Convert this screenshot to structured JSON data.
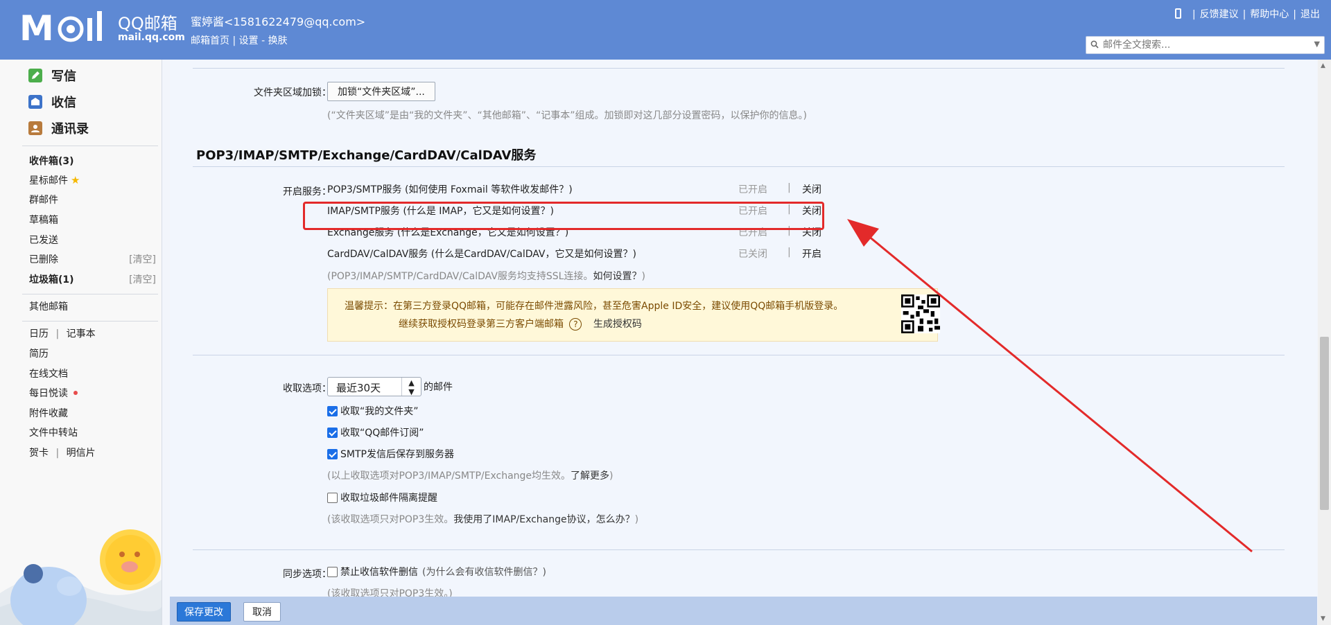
{
  "header": {
    "logo_text": "M",
    "logo_brand": "QQ邮箱",
    "logo_domain": "mail.qq.com",
    "user_display": "蜜婷酱<1581622479@qq.com>",
    "links": {
      "home": "邮箱首页",
      "settings": "设置",
      "skin": "换肤"
    },
    "right_links": {
      "feedback": "反馈建议",
      "help": "帮助中心",
      "logout": "退出"
    },
    "search_placeholder": "邮件全文搜索..."
  },
  "sidebar": {
    "actions": {
      "write": "写信",
      "receive": "收信",
      "contacts": "通讯录"
    },
    "folders": {
      "inbox": "收件箱(3)",
      "starred": "星标邮件",
      "group": "群邮件",
      "drafts": "草稿箱",
      "sent": "已发送",
      "deleted": "已删除",
      "deleted_clear": "[清空]",
      "spam": "垃圾箱(1)",
      "spam_clear": "[清空]",
      "other_mailboxes": "其他邮箱",
      "calendar": "日历",
      "notepad": "记事本",
      "resume": "简历",
      "online_docs": "在线文档",
      "daily_reading": "每日悦读",
      "attachments": "附件收藏",
      "file_transfer": "文件中转站",
      "cards": "贺卡",
      "postcards": "明信片"
    },
    "colors": {
      "star": "#f5b800",
      "dot": "#e74c4c"
    }
  },
  "main": {
    "folder_lock": {
      "label": "文件夹区域加锁：",
      "button": "加锁“文件夹区域”...",
      "hint": "(“文件夹区域”是由“我的文件夹”、“其他邮箱”、“记事本”组成。加锁即对这几部分设置密码，以保护你的信息。)"
    },
    "section_title": "POP3/IMAP/SMTP/Exchange/CardDAV/CalDAV服务",
    "services_label": "开启服务：",
    "services": [
      {
        "name": "POP3/SMTP服务 (如何使用 Foxmail 等软件收发邮件？)",
        "state": "已开启",
        "action": "关闭"
      },
      {
        "name": "IMAP/SMTP服务 (什么是 IMAP，它又是如何设置？)",
        "state": "已开启",
        "action": "关闭"
      },
      {
        "name": "Exchange服务 (什么是Exchange，它又是如何设置？)",
        "state": "已开启",
        "action": "关闭"
      },
      {
        "name": "CardDAV/CalDAV服务 (什么是CardDAV/CalDAV，它又是如何设置？)",
        "state": "已关闭",
        "action": "开启"
      }
    ],
    "services_sep": "|",
    "ssl_hint": "(POP3/IMAP/SMTP/CardDAV/CalDAV服务均支持SSL连接。",
    "ssl_hint_link": "如何设置？",
    "ssl_hint_end": ")",
    "warning": {
      "line1": "温馨提示：在第三方登录QQ邮箱，可能存在邮件泄露风险，甚至危害Apple ID安全，建议使用QQ邮箱手机版登录。",
      "line2": "继续获取授权码登录第三方客户端邮箱",
      "help_glyph": "?",
      "generate": "生成授权码"
    },
    "receive": {
      "label": "收取选项：",
      "select_value": "最近30天",
      "select_suffix": "的邮件",
      "options": [
        {
          "label": "收取“我的文件夹”",
          "checked": true
        },
        {
          "label": "收取“QQ邮件订阅”",
          "checked": true
        },
        {
          "label": "SMTP发信后保存到服务器",
          "checked": true
        }
      ],
      "hint1": "(以上收取选项对POP3/IMAP/SMTP/Exchange均生效。",
      "hint1_link": "了解更多",
      "hint1_end": ")",
      "spam_option": {
        "label": "收取垃圾邮件隔离提醒",
        "checked": false
      },
      "hint2": "(该收取选项只对POP3生效。",
      "hint2_link": "我使用了IMAP/Exchange协议，怎么办？",
      "hint2_end": ")"
    },
    "sync": {
      "label": "同步选项：",
      "option": {
        "label": "禁止收信软件删信",
        "checked": false
      },
      "option_hint": "(为什么会有收信软件删信？)",
      "hint": "(该收取选项只对POP3生效。)"
    },
    "footer": {
      "save": "保存更改",
      "cancel": "取消"
    }
  },
  "colors": {
    "header_bg": "#5e89d4",
    "accent": "#2b78d8",
    "annotation_red": "#e32a2a",
    "warn_bg": "#fff8d9"
  }
}
